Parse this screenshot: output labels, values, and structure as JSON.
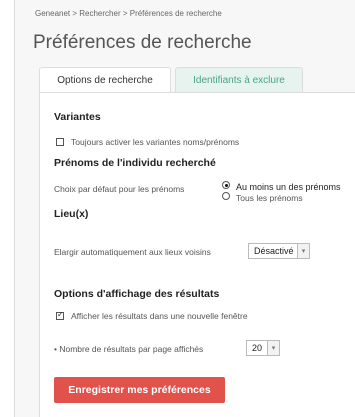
{
  "breadcrumb": "Geneanet > Rechercher > Préférences de recherche",
  "page_title": "Préférences de recherche",
  "tabs": [
    {
      "label": "Options de recherche",
      "active": true
    },
    {
      "label": "Identifiants à exclure",
      "active": false
    }
  ],
  "variantes": {
    "title": "Variantes",
    "checkbox_label": "Toujours activer les variantes noms/prénoms",
    "checked": false
  },
  "prenoms": {
    "title": "Prénoms de l'individu recherché",
    "label": "Choix par défaut pour les prénoms",
    "options": [
      "Au moins un des prénoms",
      "Tous les prénoms"
    ],
    "selected_index": 0
  },
  "lieu": {
    "title": "Lieu(x)",
    "label": "Elargir automatiquement aux lieux voisins",
    "select_value": "Désactivé"
  },
  "affichage": {
    "title": "Options d'affichage des résultats",
    "checkbox_label": "Afficher les résultats dans une nouvelle fenêtre",
    "checked": true,
    "per_page_label": "• Nombre de résultats par page affichés",
    "per_page_value": "20"
  },
  "save_label": "Enregistrer mes préférences",
  "colors": {
    "accent_green": "#4aa38a",
    "button_red": "#e0524a"
  }
}
